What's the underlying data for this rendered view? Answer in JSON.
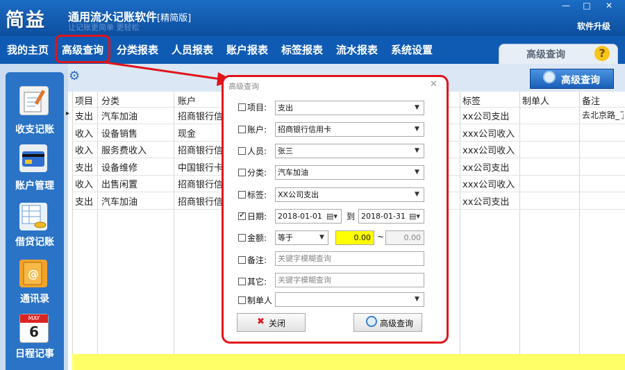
{
  "app": {
    "logo": "简益",
    "title": "通用流水记账软件",
    "edition": "[精简版]",
    "subtitle": "让记账更简单 更轻松",
    "upgrade": "软件升级",
    "window_controls": [
      "—",
      "□",
      "✕"
    ]
  },
  "nav": {
    "items": [
      "我的主页",
      "高级查询",
      "分类报表",
      "人员报表",
      "账户报表",
      "标签报表",
      "流水报表",
      "系统设置"
    ],
    "active_index": 1,
    "tab_label": "高级查询",
    "help_icon": "?"
  },
  "sidebar": {
    "items": [
      {
        "label": "收支记账",
        "icon": "notepad-icon"
      },
      {
        "label": "账户管理",
        "icon": "card-icon"
      },
      {
        "label": "借贷记账",
        "icon": "coins-icon"
      },
      {
        "label": "通讯录",
        "icon": "contacts-icon"
      },
      {
        "label": "日程记事",
        "icon": "calendar-icon"
      }
    ],
    "calendar": {
      "month": "MAY",
      "day": "6"
    }
  },
  "toolbar": {
    "adv_search_button": "高级查询"
  },
  "table": {
    "headers": [
      "项目",
      "分类",
      "账户",
      "标签",
      "制单人",
      "备注"
    ],
    "rows": [
      {
        "item": "支出",
        "category": "汽车加油",
        "account": "招商银行信",
        "tag": "xx公司支出",
        "maker": "",
        "note": "去北京路_了"
      },
      {
        "item": "收入",
        "category": "设备销售",
        "account": "现金",
        "tag": "xxx公司收入",
        "maker": "",
        "note": ""
      },
      {
        "item": "收入",
        "category": "服务费收入",
        "account": "招商银行信",
        "tag": "xxx公司收入",
        "maker": "",
        "note": ""
      },
      {
        "item": "支出",
        "category": "设备维修",
        "account": "中国银行卡",
        "tag": "xx公司支出",
        "maker": "",
        "note": ""
      },
      {
        "item": "收入",
        "category": "出售闲置",
        "account": "招商银行信",
        "tag": "xxx公司收入",
        "maker": "",
        "note": ""
      },
      {
        "item": "支出",
        "category": "汽车加油",
        "account": "招商银行信",
        "tag": "xx公司支出",
        "maker": "",
        "note": ""
      }
    ],
    "row_marker": "▸"
  },
  "dialog": {
    "title": "高级查询",
    "close": "✕",
    "fields": {
      "item": {
        "label": "项目:",
        "value": "支出"
      },
      "account": {
        "label": "账户:",
        "value": "招商银行信用卡"
      },
      "person": {
        "label": "人员:",
        "value": "张三"
      },
      "category": {
        "label": "分类:",
        "value": "汽车加油"
      },
      "tag": {
        "label": "标签:",
        "value": "XX公司支出"
      },
      "date": {
        "label": "日期:",
        "from": "2018-01-01",
        "to_label": "到",
        "to": "2018-01-31"
      },
      "amount": {
        "label": "金额:",
        "op": "等于",
        "min": "0.00",
        "sep": "~",
        "max": "0.00"
      },
      "note": {
        "label": "备注:",
        "placeholder": "关键字模糊查询"
      },
      "other": {
        "label": "其它:",
        "placeholder": "关键字模糊查询"
      },
      "maker": {
        "label": "制单人",
        "value": ""
      }
    },
    "close_button": "关闭",
    "search_button": "高级查询"
  },
  "colors": {
    "accent_red": "#e0131a",
    "nav_blue": "#0f5bb4",
    "highlight_yellow": "#ffff00"
  }
}
